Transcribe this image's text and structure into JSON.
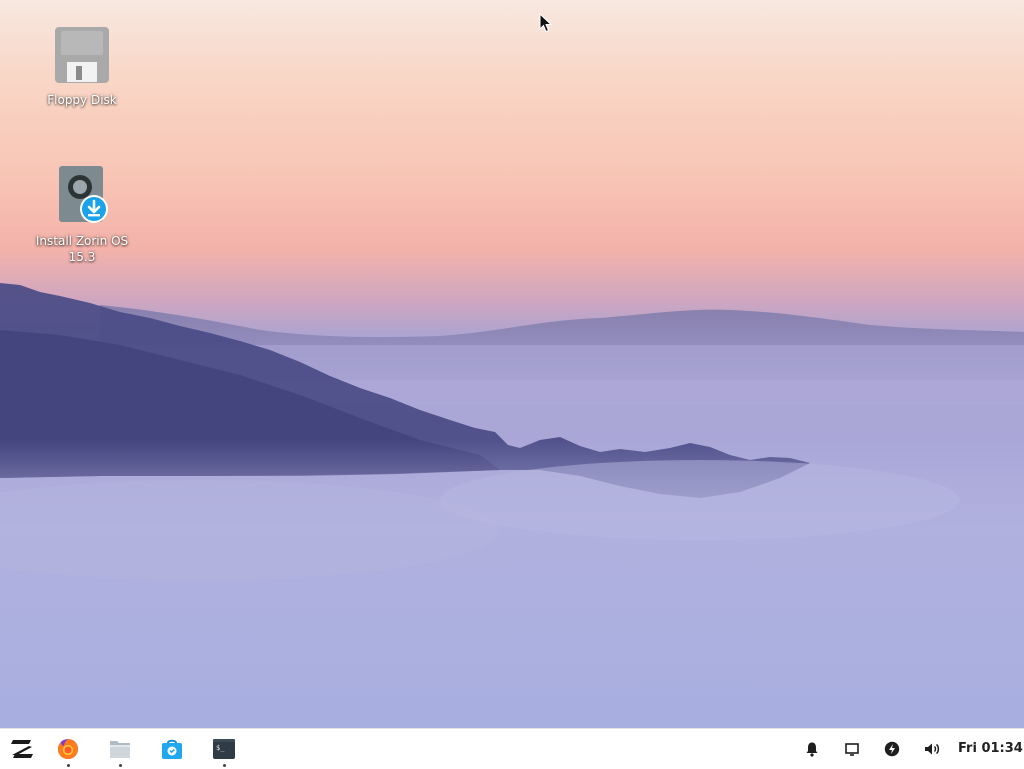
{
  "desktop": {
    "icons": [
      {
        "label": "Floppy Disk",
        "icon": "floppy-disk-icon"
      },
      {
        "label": "Install Zorin OS 15.3",
        "icon": "install-drive-icon"
      }
    ]
  },
  "taskbar": {
    "menu_icon": "zorin-logo-icon",
    "apps": [
      {
        "icon": "firefox-icon",
        "running": true
      },
      {
        "icon": "files-icon",
        "running": true
      },
      {
        "icon": "software-store-icon",
        "running": false
      },
      {
        "icon": "terminal-icon",
        "running": true
      }
    ],
    "tray": {
      "icons": [
        "bell-icon",
        "display-icon",
        "power-icon",
        "volume-icon"
      ],
      "clock": "Fri 01:34"
    }
  },
  "colors": {
    "taskbar_bg": "#ffffff",
    "install_badge": "#1aa3e8",
    "zorin_logo": "#1b1b1b"
  }
}
